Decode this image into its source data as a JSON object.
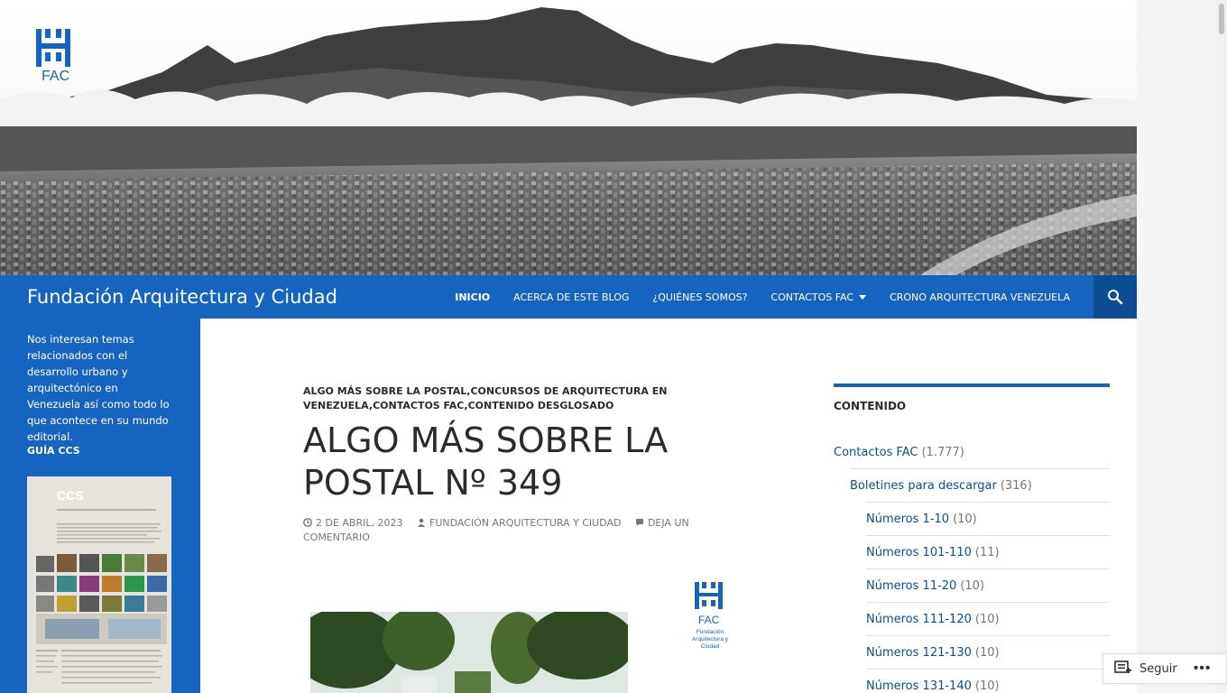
{
  "site": {
    "logo_text": "FAC",
    "title": "Fundación Arquitectura y Ciudad",
    "brand_color": "#1565c0",
    "brand_dark": "#0d4d95"
  },
  "nav": {
    "items": [
      {
        "label": "INICIO"
      },
      {
        "label": "ACERCA DE ESTE BLOG"
      },
      {
        "label": "¿QUIÉNES SOMOS?"
      },
      {
        "label": "CONTACTOS FAC"
      },
      {
        "label": "CRONO ARQUITECTURA VENEZUELA"
      }
    ],
    "search_icon": "search-icon"
  },
  "left_sidebar": {
    "description": "Nos interesan temas relacionados con el desarrollo urbano y arquitectónico en Venezuela así como todo lo que acontece en su mundo editorial.",
    "guide_title": "GUÍA CCS",
    "guide_thumb_heading": "CCS"
  },
  "post": {
    "categories": "ALGO MÁS SOBRE LA POSTAL,CONCURSOS DE ARQUITECTURA EN VENEZUELA,CONTACTOS FAC,CONTENIDO DESGLOSADO",
    "title": "ALGO MÁS SOBRE LA POSTAL Nº 349",
    "date": "2 DE ABRIL, 2023",
    "author": "FUNDACIÓN ARQUITECTURA Y CIUDAD",
    "comment": "DEJA UN COMENTARIO",
    "logo_text": "FAC",
    "logo_sub": "Fundación Arquitectura y Ciudad"
  },
  "right_sidebar": {
    "widget_title": "CONTENIDO",
    "categories": [
      {
        "label": "Contactos FAC",
        "count": "(1.777)",
        "level": 0
      },
      {
        "label": "Boletines para descargar",
        "count": "(316)",
        "level": 1
      },
      {
        "label": "Números 1-10",
        "count": "(10)",
        "level": 2
      },
      {
        "label": "Números 101-110",
        "count": "(11)",
        "level": 2
      },
      {
        "label": "Números 11-20",
        "count": "(10)",
        "level": 2
      },
      {
        "label": "Números 111-120",
        "count": "(10)",
        "level": 2
      },
      {
        "label": "Números 121-130",
        "count": "(10)",
        "level": 2
      },
      {
        "label": "Números 131-140",
        "count": "(10)",
        "level": 2
      }
    ]
  },
  "follow": {
    "label": "Seguir",
    "more": "•••"
  }
}
